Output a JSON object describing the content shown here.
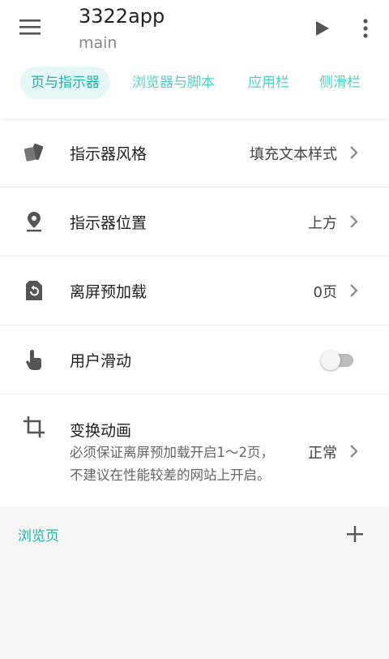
{
  "appbar": {
    "title": "3322app",
    "subtitle": "main"
  },
  "tabs": [
    {
      "label": "页与指示器",
      "active": true
    },
    {
      "label": "浏览器与脚本",
      "active": false
    },
    {
      "label": "应用栏",
      "active": false
    },
    {
      "label": "侧滑栏",
      "active": false
    }
  ],
  "settings": {
    "indicator_style": {
      "label": "指示器风格",
      "value": "填充文本样式",
      "icon": "style-cards-icon"
    },
    "indicator_position": {
      "label": "指示器位置",
      "value": "上方",
      "icon": "location-pin-icon"
    },
    "offscreen_preload": {
      "label": "离屏预加载",
      "value": "0页",
      "icon": "restore-page-icon"
    },
    "user_swipe": {
      "label": "用户滑动",
      "enabled": false,
      "icon": "touch-hand-icon"
    },
    "transition_animation": {
      "label": "变换动画",
      "desc_line1": "必须保证离屏预加载开启1～2页，",
      "desc_line2": "不建议在性能较差的网站上开启。",
      "value": "正常",
      "icon": "crop-icon"
    }
  },
  "browser_pages": {
    "title": "浏览页"
  },
  "colors": {
    "accent": "#18b9ac",
    "accent_light": "#4cd3c8",
    "tab_active_bg": "#e6f8f6"
  }
}
